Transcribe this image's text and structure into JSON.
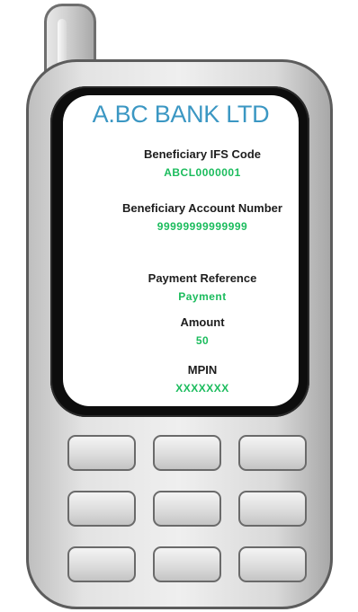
{
  "screen": {
    "bank_name": "A.BC BANK LTD",
    "fields": [
      {
        "label": "Beneficiary IFS Code",
        "value": "ABCL0000001"
      },
      {
        "label": "Beneficiary Account Number",
        "value": "99999999999999"
      },
      {
        "label": "Payment Reference",
        "value": "Payment"
      },
      {
        "label": "Amount",
        "value": "50"
      },
      {
        "label": "MPIN",
        "value": "XXXXXXX"
      }
    ]
  },
  "colors": {
    "title": "#3b97c3",
    "value": "#1bbc5d",
    "label": "#1d1d1d",
    "bezel": "#0d0d0d"
  }
}
